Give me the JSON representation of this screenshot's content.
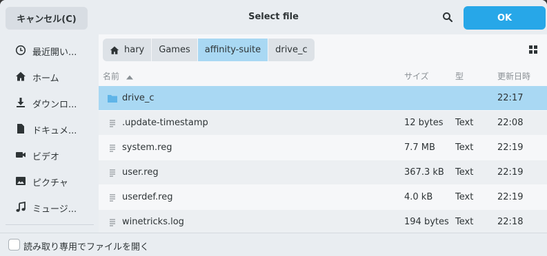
{
  "header": {
    "cancel_label": "キャンセル(C)",
    "title": "Select file",
    "ok_label": "OK"
  },
  "sidebar": {
    "items": [
      {
        "icon": "clock-icon",
        "label": "最近開い..."
      },
      {
        "icon": "home-icon",
        "label": "ホーム"
      },
      {
        "icon": "download-icon",
        "label": "ダウンロ..."
      },
      {
        "icon": "document-icon",
        "label": "ドキュメ..."
      },
      {
        "icon": "video-icon",
        "label": "ビデオ"
      },
      {
        "icon": "picture-icon",
        "label": "ピクチャ"
      },
      {
        "icon": "music-icon",
        "label": "ミュージ..."
      }
    ]
  },
  "pathbar": {
    "crumbs": [
      "hary",
      "Games",
      "affinity-suite",
      "drive_c"
    ],
    "active_index": 2
  },
  "columns": {
    "name": "名前",
    "size": "サイズ",
    "type": "型",
    "modified": "更新日時"
  },
  "files": [
    {
      "name": "drive_c",
      "size": "",
      "type": "",
      "time": "22:17",
      "kind": "folder"
    },
    {
      "name": ".update-timestamp",
      "size": "12 bytes",
      "type": "Text",
      "time": "22:08",
      "kind": "text"
    },
    {
      "name": "system.reg",
      "size": "7.7 MB",
      "type": "Text",
      "time": "22:19",
      "kind": "text"
    },
    {
      "name": "user.reg",
      "size": "367.3 kB",
      "type": "Text",
      "time": "22:19",
      "kind": "text"
    },
    {
      "name": "userdef.reg",
      "size": "4.0 kB",
      "type": "Text",
      "time": "22:19",
      "kind": "text"
    },
    {
      "name": "winetricks.log",
      "size": "194 bytes",
      "type": "Text",
      "time": "22:18",
      "kind": "text"
    }
  ],
  "footer": {
    "readonly_label": "読み取り専用でファイルを開く",
    "readonly_checked": false
  },
  "colors": {
    "accent": "#27a7e8",
    "selection": "#a9d8f3",
    "folder": "#5fb4e8"
  }
}
